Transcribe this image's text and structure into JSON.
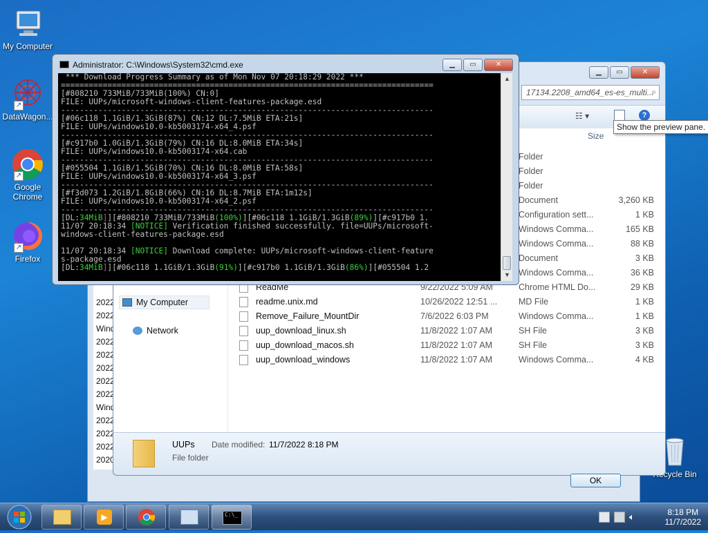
{
  "desktop": {
    "icons": [
      {
        "label": "My Computer"
      },
      {
        "label": "DataWagon..."
      },
      {
        "label": "Google Chrome"
      },
      {
        "label": "Firefox"
      },
      {
        "label": "Recycle Bin"
      }
    ]
  },
  "explorer": {
    "search_placeholder": "17134.2208_amd64_es-es_multi...",
    "column_size": "Size",
    "tooltip": "Show the preview pane.",
    "nav": {
      "computer": "My Computer",
      "network": "Network"
    },
    "rows": [
      {
        "name": "",
        "date": "",
        "type": "Folder",
        "size": ""
      },
      {
        "name": "",
        "date": "",
        "type": "Folder",
        "size": ""
      },
      {
        "name": "",
        "date": "",
        "type": "Folder",
        "size": ""
      },
      {
        "name": "",
        "date": "",
        "type": "Document",
        "size": "3,260 KB"
      },
      {
        "name": "",
        "date": "",
        "type": "Configuration sett...",
        "size": "1 KB"
      },
      {
        "name": "",
        "date": "",
        "type": "Windows Comma...",
        "size": "165 KB"
      },
      {
        "name": "",
        "date": "",
        "type": "Windows Comma...",
        "size": "88 KB"
      },
      {
        "name": "",
        "date": "",
        "type": "Document",
        "size": "3 KB"
      },
      {
        "name": "",
        "date": "",
        "type": "Windows Comma...",
        "size": "36 KB"
      },
      {
        "name": "ReadMe",
        "date": "9/22/2022 5:09 AM",
        "type": "Chrome HTML Do...",
        "size": "29 KB"
      },
      {
        "name": "readme.unix.md",
        "date": "10/26/2022 12:51 ...",
        "type": "MD File",
        "size": "1 KB"
      },
      {
        "name": "Remove_Failure_MountDir",
        "date": "7/6/2022 6:03 PM",
        "type": "Windows Comma...",
        "size": "1 KB"
      },
      {
        "name": "uup_download_linux.sh",
        "date": "11/8/2022 1:07 AM",
        "type": "SH File",
        "size": "3 KB"
      },
      {
        "name": "uup_download_macos.sh",
        "date": "11/8/2022 1:07 AM",
        "type": "SH File",
        "size": "3 KB"
      },
      {
        "name": "uup_download_windows",
        "date": "11/8/2022 1:07 AM",
        "type": "Windows Comma...",
        "size": "4 KB"
      }
    ],
    "details": {
      "name": "UUPs",
      "date_label": "Date modified:",
      "date": "11/7/2022 8:18 PM",
      "type": "File folder"
    }
  },
  "back_dialog": {
    "years": [
      "2022",
      "2022",
      "Wind",
      "2022",
      "2022",
      "2022",
      "2022",
      "2022",
      "Wind",
      "2022",
      "2022",
      "2022",
      "2020"
    ],
    "ok": "OK"
  },
  "cmd": {
    "title": "Administrator: C:\\Windows\\System32\\cmd.exe",
    "lines": [
      " *** Download Progress Summary as of Mon Nov 07 20:18:29 2022 ***",
      "================================================================================",
      "[#808210 733MiB/733MiB(100%) CN:0]",
      "FILE: UUPs/microsoft-windows-client-features-package.esd",
      "--------------------------------------------------------------------------------",
      "[#06c118 1.1GiB/1.3GiB(87%) CN:12 DL:7.5MiB ETA:21s]",
      "FILE: UUPs/windows10.0-kb5003174-x64_4.psf",
      "--------------------------------------------------------------------------------",
      "[#c917b0 1.0GiB/1.3GiB(79%) CN:16 DL:8.0MiB ETA:34s]",
      "FILE: UUPs/windows10.0-kb5003174-x64.cab",
      "--------------------------------------------------------------------------------",
      "[#055504 1.1GiB/1.5GiB(70%) CN:16 DL:8.0MiB ETA:58s]",
      "FILE: UUPs/windows10.0-kb5003174-x64_3.psf",
      "--------------------------------------------------------------------------------",
      "[#f3d073 1.2GiB/1.8GiB(66%) CN:16 DL:8.7MiB ETA:1m12s]",
      "FILE: UUPs/windows10.0-kb5003174-x64_2.psf",
      "--------------------------------------------------------------------------------",
      ""
    ],
    "status1_a": "[DL:",
    "status1_dl": "34MiB",
    "status1_b": "][#808210 733MiB/733MiB",
    "status1_p1": "(100%)",
    "status1_c": "][#06c118 1.1GiB/1.3GiB",
    "status1_p2": "(89%)",
    "status1_d": "][#c917b0 1.",
    "notice1_a": "11/07 20:18:34 ",
    "notice_tag": "[NOTICE]",
    "notice1_b": " Verification finished successfully. file=UUPs/microsoft-",
    "notice1_c": "windows-client-features-package.esd",
    "notice2_a": "11/07 20:18:34 ",
    "notice2_b": " Download complete: UUPs/microsoft-windows-client-feature",
    "notice2_c": "s-package.esd",
    "status2_a": "[DL:",
    "status2_dl": "34MiB",
    "status2_b": "][#06c118 1.1GiB/1.3GiB",
    "status2_p1": "(91%)",
    "status2_c": "][#c917b0 1.1GiB/1.3GiB",
    "status2_p2": "(86%)",
    "status2_d": "][#055504 1.2"
  },
  "taskbar": {
    "time": "8:18 PM",
    "date": "11/7/2022"
  }
}
